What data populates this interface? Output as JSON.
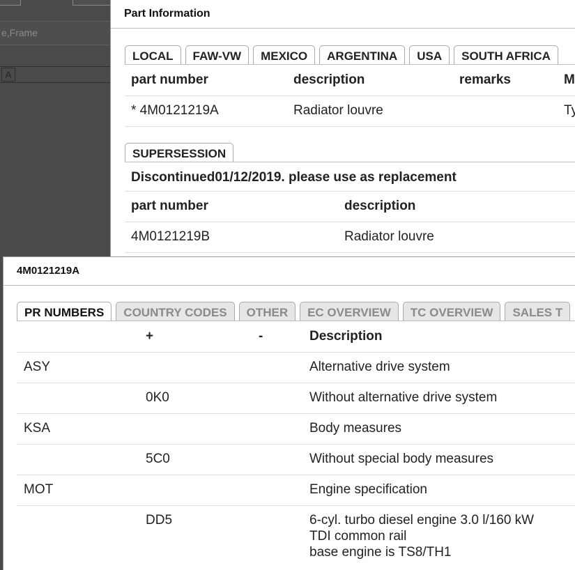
{
  "background": {
    "field_text": "e,Frame",
    "font_icon_text": "A"
  },
  "part_dialog": {
    "title": "Part Information",
    "tabs": [
      "LOCAL",
      "FAW-VW",
      "MEXICO",
      "ARGENTINA",
      "USA",
      "SOUTH AFRICA"
    ],
    "columns": [
      "part number",
      "description",
      "remarks",
      "M"
    ],
    "row": {
      "part_number": "* 4M0121219A",
      "description": "Radiator louvre",
      "remarks": "",
      "extra": "Ty"
    },
    "supersession_tab": "SUPERSESSION",
    "supersession_note": "Discontinued01/12/2019. please use as replacement",
    "replacement_columns": [
      "part number",
      "description"
    ],
    "replacement_row": {
      "part_number": "4M0121219B",
      "description": "Radiator louvre"
    }
  },
  "pr_dialog": {
    "title": "4M0121219A",
    "tabs": [
      "PR NUMBERS",
      "COUNTRY CODES",
      "OTHER",
      "EC OVERVIEW",
      "TC OVERVIEW",
      "SALES T"
    ],
    "columns": {
      "plus": "+",
      "minus": "-",
      "description": "Description"
    },
    "rows": [
      {
        "family": "ASY",
        "plus": "",
        "minus": "",
        "description": [
          "Alternative drive system"
        ]
      },
      {
        "family": "",
        "plus": "0K0",
        "minus": "",
        "description": [
          "Without alternative drive system"
        ]
      },
      {
        "family": "KSA",
        "plus": "",
        "minus": "",
        "description": [
          "Body measures"
        ]
      },
      {
        "family": "",
        "plus": "5C0",
        "minus": "",
        "description": [
          "Without special body measures"
        ]
      },
      {
        "family": "MOT",
        "plus": "",
        "minus": "",
        "description": [
          "Engine specification"
        ]
      },
      {
        "family": "",
        "plus": "DD5",
        "minus": "",
        "description": [
          "6-cyl. turbo diesel engine 3.0 l/160 kW",
          "TDI common rail",
          "base engine is TS8/TH1"
        ]
      }
    ]
  }
}
